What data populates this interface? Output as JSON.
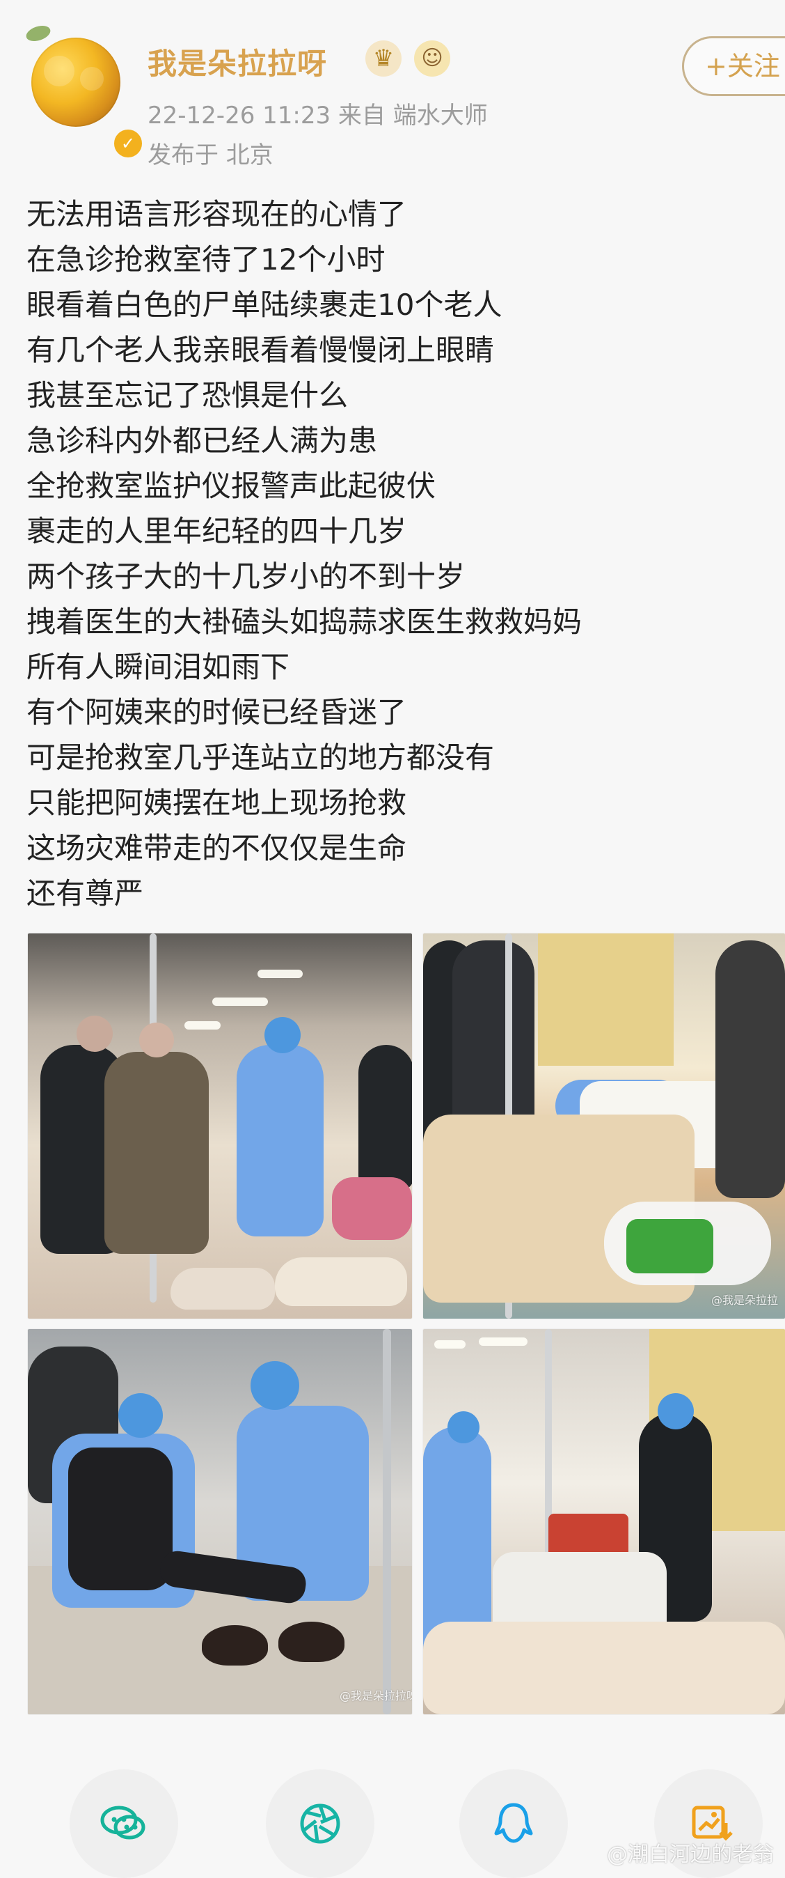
{
  "header": {
    "username": "我是朵拉拉呀",
    "follow_label": "+关注",
    "meta": "22-12-26 11:23  来自 端水大师",
    "location": "发布于 北京"
  },
  "post": {
    "lines": [
      "无法用语言形容现在的心情了",
      "在急诊抢救室待了12个小时",
      "眼看着白色的尸单陆续裹走10个老人",
      "有几个老人我亲眼看着慢慢闭上眼睛",
      "我甚至忘记了恐惧是什么",
      "急诊科内外都已经人满为患",
      "全抢救室监护仪报警声此起彼伏",
      "裹走的人里年纪轻的四十几岁",
      "两个孩子大的十几岁小的不到十岁",
      "拽着医生的大褂磕头如捣蒜求医生救救妈妈",
      "所有人瞬间泪如雨下",
      "有个阿姨来的时候已经昏迷了",
      "可是抢救室几乎连站立的地方都没有",
      "只能把阿姨摆在地上现场抢救",
      "这场灾难带走的不仅仅是生命",
      "还有尊严"
    ]
  },
  "images": {
    "watermark_top_right": "@我是朵拉拉",
    "watermark_bottom_left": "@我是朵拉拉呀"
  },
  "footer": {
    "watermark": "@潮白河边的老翁"
  },
  "icons": {
    "avatar": "avatar",
    "verify": "verified-badge-icon",
    "crown": "crown-icon",
    "emoji": "emoji-icon",
    "wechat": "wechat-icon",
    "moments": "moments-icon",
    "qq": "qq-icon",
    "save": "save-image-icon"
  },
  "colors": {
    "username": "#d8a24f",
    "follow": "#d4a24f",
    "meta": "#9c9c9c",
    "share_bg": "#efefef"
  }
}
